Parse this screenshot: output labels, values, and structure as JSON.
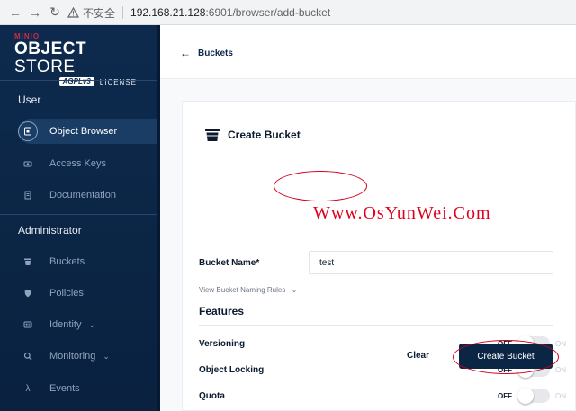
{
  "browser": {
    "insecure_label": "不安全",
    "url_host": "192.168.21.128",
    "url_path": ":6901/browser/add-bucket"
  },
  "sidebar": {
    "logo_top": "MINIO",
    "logo_main_bold": "OBJECT",
    "logo_main_thin": " STORE",
    "logo_badge": "AGPLv3",
    "logo_license": "LICENSE",
    "user_section": "User",
    "admin_section": "Administrator",
    "items": [
      {
        "label": "Object Browser",
        "icon": "folder-icon",
        "active": true
      },
      {
        "label": "Access Keys",
        "icon": "key-icon"
      },
      {
        "label": "Documentation",
        "icon": "document-icon"
      },
      {
        "label": "Buckets",
        "icon": "bucket-icon"
      },
      {
        "label": "Policies",
        "icon": "shield-icon"
      },
      {
        "label": "Identity",
        "icon": "identity-icon",
        "chevron": "⌄"
      },
      {
        "label": "Monitoring",
        "icon": "search-icon",
        "chevron": "⌄"
      },
      {
        "label": "Events",
        "icon": "lambda-icon"
      }
    ]
  },
  "header": {
    "back_label": "Buckets"
  },
  "form": {
    "title": "Create Bucket",
    "bucket_name_label": "Bucket Name*",
    "bucket_name_value": "test",
    "rules_label": "View Bucket Naming Rules",
    "features_label": "Features",
    "toggles": [
      {
        "label": "Versioning",
        "off": "OFF",
        "on": "ON",
        "enabled": false
      },
      {
        "label": "Object Locking",
        "off": "OFF",
        "on": "ON",
        "enabled": false
      },
      {
        "label": "Quota",
        "off": "OFF",
        "on": "ON",
        "enabled": false
      }
    ],
    "clear_label": "Clear",
    "create_label": "Create Bucket"
  },
  "watermark": "Www.OsYunWei.Com",
  "colors": {
    "sidebar_bg": "#0d2a4e",
    "primary_button": "#0b2544",
    "annotation": "#d0021b",
    "watermark": "#e0001c"
  }
}
